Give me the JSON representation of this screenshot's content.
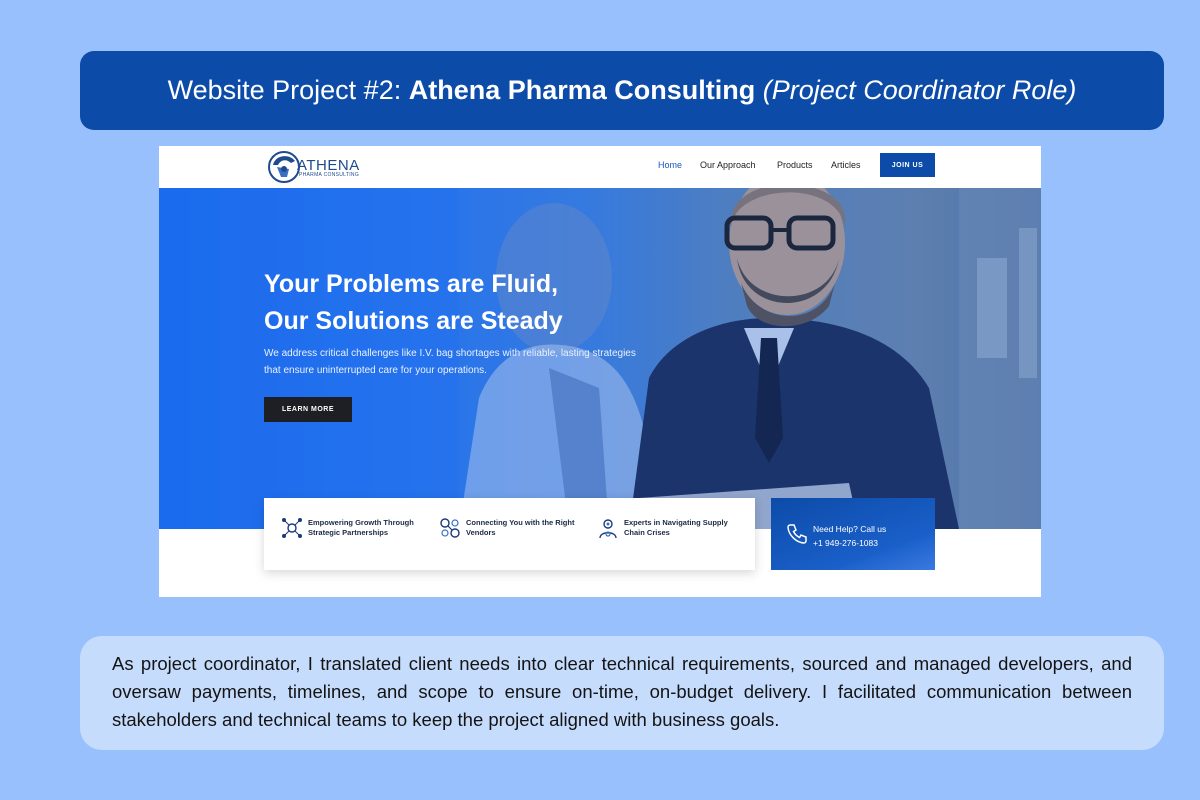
{
  "slide": {
    "title_prefix": "Website Project #2: ",
    "title_bold": "Athena Pharma Consulting",
    "title_italic": "(Project Coordinator Role)",
    "description": "As project coordinator, I translated client needs into clear technical requirements, sourced and managed developers, and oversaw payments, timelines, and scope to ensure on-time, on-budget delivery. I facilitated communication between stakeholders and technical teams to keep the project aligned with business goals."
  },
  "site": {
    "logo_text": "ATHENA",
    "logo_sub": "PHARMA CONSULTING",
    "nav": {
      "home": "Home",
      "approach": "Our Approach",
      "products": "Products",
      "articles": "Articles",
      "join": "JOIN US"
    },
    "hero": {
      "title_line1": "Your Problems are Fluid,",
      "title_line2": "Our Solutions are Steady",
      "text": "We address critical challenges like I.V. bag shortages with reliable, lasting strategies that ensure uninterrupted care for your operations.",
      "cta": "LEARN MORE"
    },
    "features": [
      {
        "icon": "growth-network-icon",
        "text": "Empowering Growth Through Strategic Partnerships"
      },
      {
        "icon": "vendors-connect-icon",
        "text": "Connecting You with the Right Vendors"
      },
      {
        "icon": "expert-gear-icon",
        "text": "Experts in Navigating Supply Chain Crises"
      }
    ],
    "help": {
      "label": "Need Help? Call us",
      "phone": "+1 949-276-1083",
      "icon": "phone-icon"
    }
  },
  "colors": {
    "page_bg": "#97c0fc",
    "banner_bg": "#0c4ba8",
    "desc_bg": "#c6dcfc",
    "accent": "#1a57c0"
  }
}
